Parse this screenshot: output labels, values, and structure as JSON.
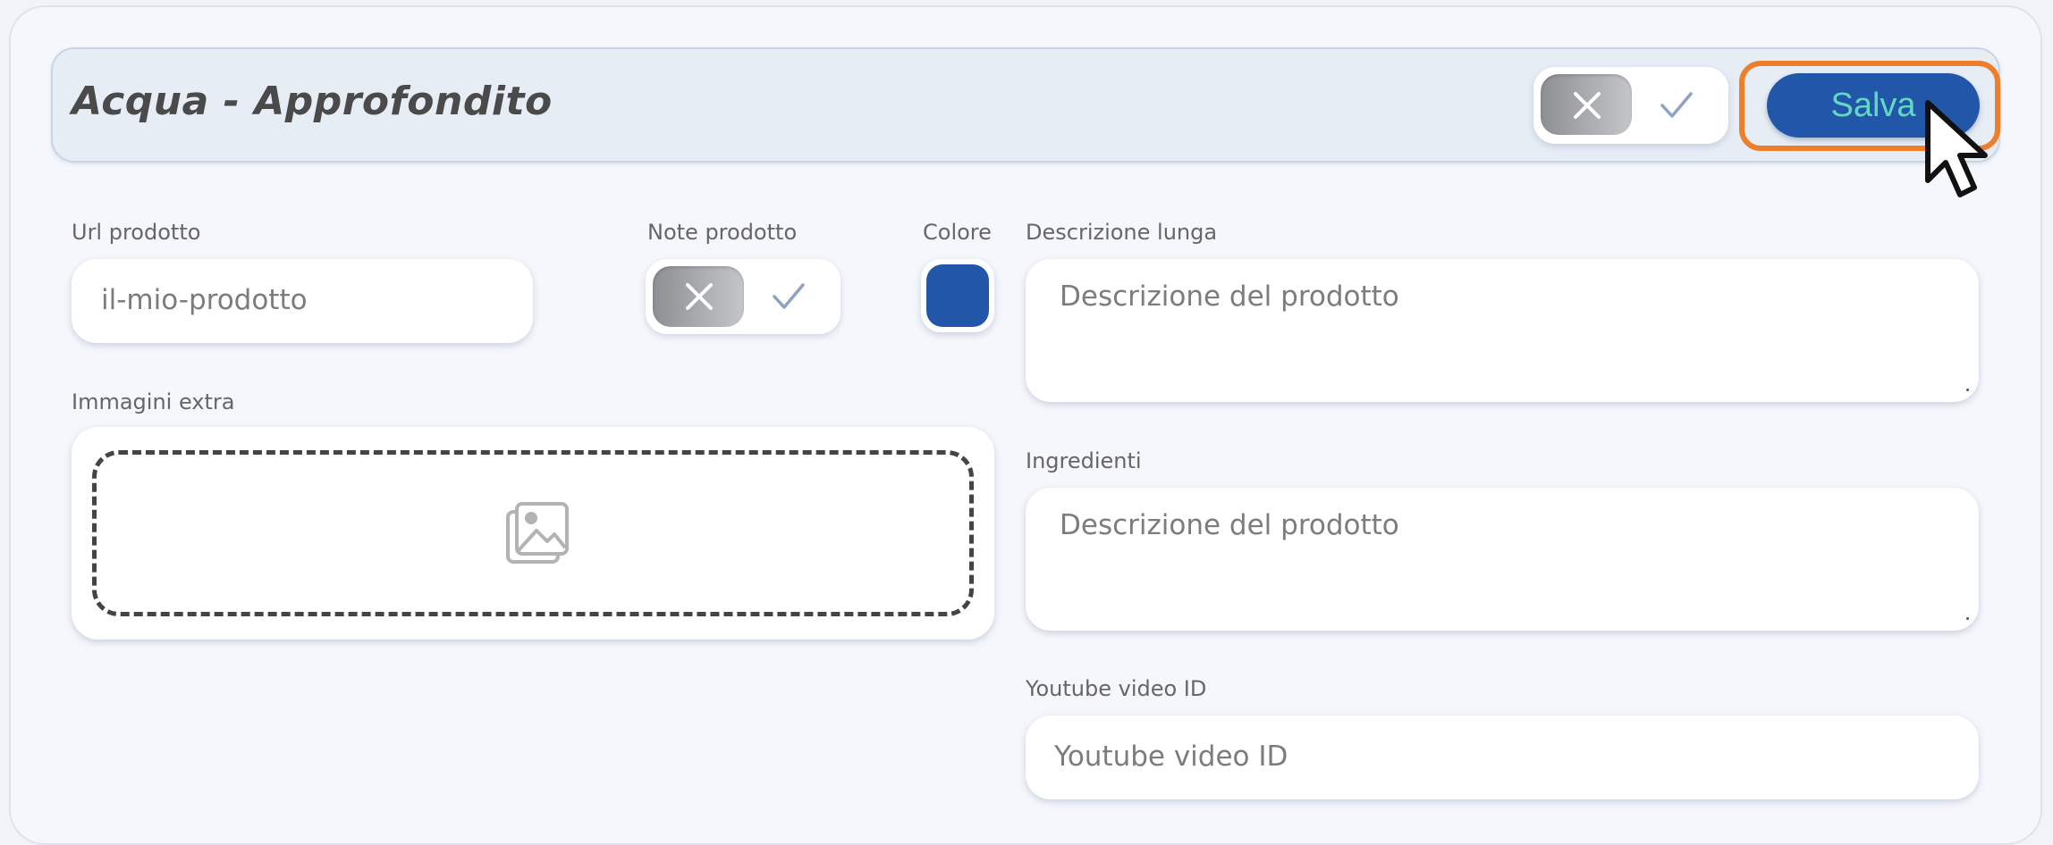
{
  "header": {
    "title": "Acqua - Approfondito",
    "save_label": "Salva"
  },
  "fields": {
    "url": {
      "label": "Url prodotto",
      "value": "il-mio-prodotto"
    },
    "note": {
      "label": "Note prodotto"
    },
    "color": {
      "label": "Colore",
      "value": "#2256a8"
    },
    "long_description": {
      "label": "Descrizione lunga",
      "placeholder": "Descrizione del prodotto"
    },
    "extra_images": {
      "label": "Immagini extra"
    },
    "ingredients": {
      "label": "Ingredienti",
      "placeholder": "Descrizione del prodotto"
    },
    "youtube": {
      "label": "Youtube video ID",
      "placeholder": "Youtube video ID"
    }
  },
  "icons": {
    "toggle_off": "close-icon",
    "toggle_on": "check-icon",
    "image_placeholder": "image-icon",
    "cursor": "mouse-pointer-icon"
  },
  "colors": {
    "accent": "#2256a8",
    "save_text": "#62d8c3",
    "highlight": "#ee7d2c"
  }
}
